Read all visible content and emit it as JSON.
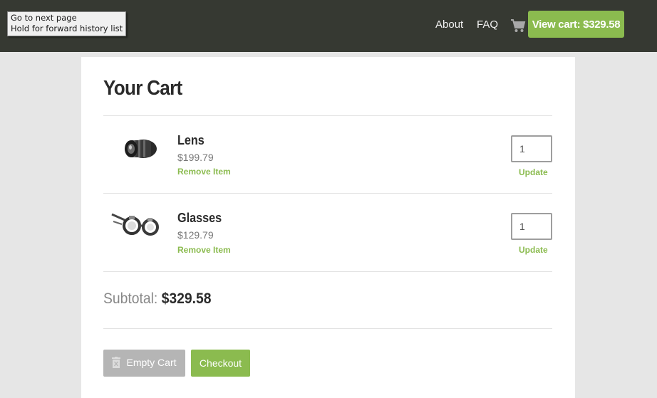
{
  "tooltip": {
    "line1": "Go to next page",
    "line2": "Hold for forward history list"
  },
  "nav": {
    "about": "About",
    "faq": "FAQ",
    "cart_icon": "shopping-cart-icon",
    "view_cart_label": "View cart: $329.58"
  },
  "cart": {
    "title": "Your Cart",
    "items": [
      {
        "name": "Lens",
        "price": "$199.79",
        "remove": "Remove Item",
        "quantity": "1",
        "update": "Update",
        "icon": "camera-lens-image"
      },
      {
        "name": "Glasses",
        "price": "$129.79",
        "remove": "Remove Item",
        "quantity": "1",
        "update": "Update",
        "icon": "steampunk-glasses-image"
      }
    ],
    "subtotal_label": "Subtotal:",
    "subtotal_value": "$329.58",
    "empty_label": "Empty Cart",
    "checkout_label": "Checkout"
  },
  "colors": {
    "accent": "#8bbb4f",
    "topbar": "#363932",
    "background": "#e6e6e6"
  }
}
